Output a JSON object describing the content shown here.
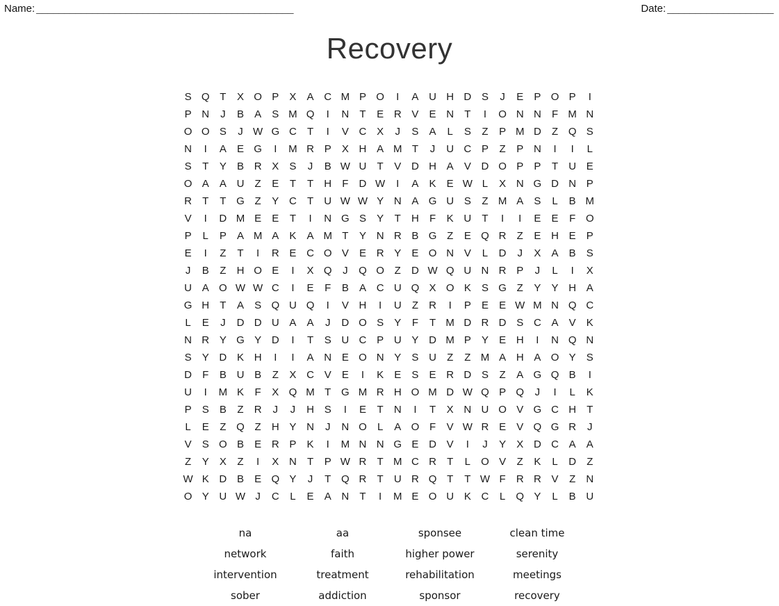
{
  "header": {
    "name_label": "Name:",
    "name_rule": "______________________________________________",
    "date_label": "Date:",
    "date_rule": "___________________"
  },
  "title": "Recovery",
  "grid": {
    "rows": 24,
    "cols": 24,
    "letters": [
      [
        "S",
        "Q",
        "T",
        "X",
        "O",
        "P",
        "X",
        "A",
        "C",
        "M",
        "P",
        "O",
        "I",
        "A",
        "U",
        "H",
        "D",
        "S",
        "J",
        "E",
        "P",
        "O",
        "P",
        "I"
      ],
      [
        "P",
        "N",
        "J",
        "B",
        "A",
        "S",
        "M",
        "Q",
        "I",
        "N",
        "T",
        "E",
        "R",
        "V",
        "E",
        "N",
        "T",
        "I",
        "O",
        "N",
        "N",
        "F",
        "M",
        "N"
      ],
      [
        "O",
        "O",
        "S",
        "J",
        "W",
        "G",
        "C",
        "T",
        "I",
        "V",
        "C",
        "X",
        "J",
        "S",
        "A",
        "L",
        "S",
        "Z",
        "P",
        "M",
        "D",
        "Z",
        "Q",
        "S"
      ],
      [
        "N",
        "I",
        "A",
        "E",
        "G",
        "I",
        "M",
        "R",
        "P",
        "X",
        "H",
        "A",
        "M",
        "T",
        "J",
        "U",
        "C",
        "P",
        "Z",
        "P",
        "N",
        "I",
        "I",
        "L"
      ],
      [
        "S",
        "T",
        "Y",
        "B",
        "R",
        "X",
        "S",
        "J",
        "B",
        "W",
        "U",
        "T",
        "V",
        "D",
        "H",
        "A",
        "V",
        "D",
        "O",
        "P",
        "P",
        "T",
        "U",
        "E"
      ],
      [
        "O",
        "A",
        "A",
        "U",
        "Z",
        "E",
        "T",
        "T",
        "H",
        "F",
        "D",
        "W",
        "I",
        "A",
        "K",
        "E",
        "W",
        "L",
        "X",
        "N",
        "G",
        "D",
        "N",
        "P"
      ],
      [
        "R",
        "T",
        "T",
        "G",
        "Z",
        "Y",
        "C",
        "T",
        "U",
        "W",
        "W",
        "Y",
        "N",
        "A",
        "G",
        "U",
        "S",
        "Z",
        "M",
        "A",
        "S",
        "L",
        "B",
        "M"
      ],
      [
        "V",
        "I",
        "D",
        "M",
        "E",
        "E",
        "T",
        "I",
        "N",
        "G",
        "S",
        "Y",
        "T",
        "H",
        "F",
        "K",
        "U",
        "T",
        "I",
        "I",
        "E",
        "E",
        "F",
        "O"
      ],
      [
        "P",
        "L",
        "P",
        "A",
        "M",
        "A",
        "K",
        "A",
        "M",
        "T",
        "Y",
        "N",
        "R",
        "B",
        "G",
        "Z",
        "E",
        "Q",
        "R",
        "Z",
        "E",
        "H",
        "E",
        "P"
      ],
      [
        "E",
        "I",
        "Z",
        "T",
        "I",
        "R",
        "E",
        "C",
        "O",
        "V",
        "E",
        "R",
        "Y",
        "E",
        "O",
        "N",
        "V",
        "L",
        "D",
        "J",
        "X",
        "A",
        "B",
        "S"
      ],
      [
        "J",
        "B",
        "Z",
        "H",
        "O",
        "E",
        "I",
        "X",
        "Q",
        "J",
        "Q",
        "O",
        "Z",
        "D",
        "W",
        "Q",
        "U",
        "N",
        "R",
        "P",
        "J",
        "L",
        "I",
        "X"
      ],
      [
        "U",
        "A",
        "O",
        "W",
        "W",
        "C",
        "I",
        "E",
        "F",
        "B",
        "A",
        "C",
        "U",
        "Q",
        "X",
        "O",
        "K",
        "S",
        "G",
        "Z",
        "Y",
        "Y",
        "H",
        "A"
      ],
      [
        "G",
        "H",
        "T",
        "A",
        "S",
        "Q",
        "U",
        "Q",
        "I",
        "V",
        "H",
        "I",
        "U",
        "Z",
        "R",
        "I",
        "P",
        "E",
        "E",
        "W",
        "M",
        "N",
        "Q",
        "C"
      ],
      [
        "L",
        "E",
        "J",
        "D",
        "D",
        "U",
        "A",
        "A",
        "J",
        "D",
        "O",
        "S",
        "Y",
        "F",
        "T",
        "M",
        "D",
        "R",
        "D",
        "S",
        "C",
        "A",
        "V",
        "K"
      ],
      [
        "N",
        "R",
        "Y",
        "G",
        "Y",
        "D",
        "I",
        "T",
        "S",
        "U",
        "C",
        "P",
        "U",
        "Y",
        "D",
        "M",
        "P",
        "Y",
        "E",
        "H",
        "I",
        "N",
        "Q",
        "N"
      ],
      [
        "S",
        "Y",
        "D",
        "K",
        "H",
        "I",
        "I",
        "A",
        "N",
        "E",
        "O",
        "N",
        "Y",
        "S",
        "U",
        "Z",
        "Z",
        "M",
        "A",
        "H",
        "A",
        "O",
        "Y",
        "S"
      ],
      [
        "D",
        "F",
        "B",
        "U",
        "B",
        "Z",
        "X",
        "C",
        "V",
        "E",
        "I",
        "K",
        "E",
        "S",
        "E",
        "R",
        "D",
        "S",
        "Z",
        "A",
        "G",
        "Q",
        "B",
        "I"
      ],
      [
        "U",
        "I",
        "M",
        "K",
        "F",
        "X",
        "Q",
        "M",
        "T",
        "G",
        "M",
        "R",
        "H",
        "O",
        "M",
        "D",
        "W",
        "Q",
        "P",
        "Q",
        "J",
        "I",
        "L",
        "K"
      ],
      [
        "P",
        "S",
        "B",
        "Z",
        "R",
        "J",
        "J",
        "H",
        "S",
        "I",
        "E",
        "T",
        "N",
        "I",
        "T",
        "X",
        "N",
        "U",
        "O",
        "V",
        "G",
        "C",
        "H",
        "T"
      ],
      [
        "L",
        "E",
        "Z",
        "Q",
        "Z",
        "H",
        "Y",
        "N",
        "J",
        "N",
        "O",
        "L",
        "A",
        "O",
        "F",
        "V",
        "W",
        "R",
        "E",
        "V",
        "Q",
        "G",
        "R",
        "J"
      ],
      [
        "V",
        "S",
        "O",
        "B",
        "E",
        "R",
        "P",
        "K",
        "I",
        "M",
        "N",
        "N",
        "G",
        "E",
        "D",
        "V",
        "I",
        "J",
        "Y",
        "X",
        "D",
        "C",
        "A",
        "A"
      ],
      [
        "Z",
        "Y",
        "X",
        "Z",
        "I",
        "X",
        "N",
        "T",
        "P",
        "W",
        "R",
        "T",
        "M",
        "C",
        "R",
        "T",
        "L",
        "O",
        "V",
        "Z",
        "K",
        "L",
        "D",
        "Z"
      ],
      [
        "W",
        "K",
        "D",
        "B",
        "E",
        "Q",
        "Y",
        "J",
        "T",
        "Q",
        "R",
        "T",
        "U",
        "R",
        "Q",
        "T",
        "T",
        "W",
        "F",
        "R",
        "R",
        "V",
        "Z",
        "N"
      ],
      [
        "O",
        "Y",
        "U",
        "W",
        "J",
        "C",
        "L",
        "E",
        "A",
        "N",
        "T",
        "I",
        "M",
        "E",
        "O",
        "U",
        "K",
        "C",
        "L",
        "Q",
        "Y",
        "L",
        "B",
        "U"
      ]
    ]
  },
  "wordlist": {
    "rows": [
      [
        "na",
        "aa",
        "sponsee",
        "clean time"
      ],
      [
        "network",
        "faith",
        "higher power",
        "serenity"
      ],
      [
        "intervention",
        "treatment",
        "rehabilitation",
        "meetings"
      ],
      [
        "sober",
        "addiction",
        "sponsor",
        "recovery"
      ]
    ]
  }
}
